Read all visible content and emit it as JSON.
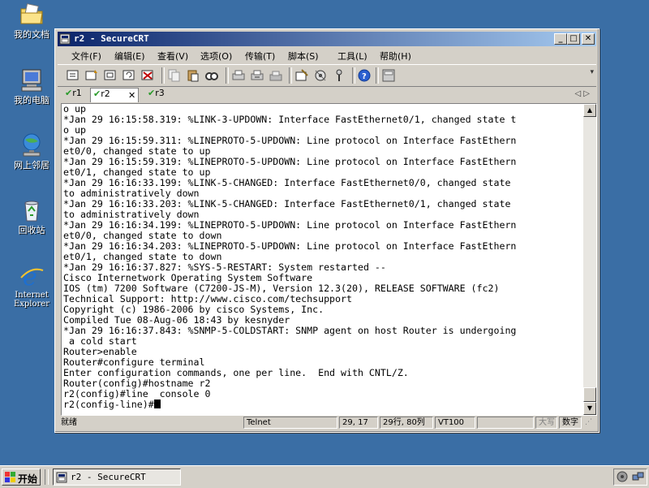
{
  "desktop": {
    "icons": [
      {
        "label": "我的文档",
        "icon": "folder-documents-icon"
      },
      {
        "label": "我的电脑",
        "icon": "computer-icon"
      },
      {
        "label": "网上邻居",
        "icon": "network-icon"
      },
      {
        "label": "回收站",
        "icon": "recycle-bin-icon"
      },
      {
        "label": "Internet Explorer",
        "icon": "ie-icon"
      }
    ]
  },
  "window": {
    "title": "r2 - SecureCRT",
    "controls": {
      "minimize": "_",
      "maximize": "□",
      "close": "✕"
    },
    "menu": [
      "文件(F)",
      "编辑(E)",
      "查看(V)",
      "选项(O)",
      "传输(T)",
      "脚本(S)",
      "工具(L)",
      "帮助(H)"
    ],
    "tabs": [
      {
        "label": "r1",
        "active": false
      },
      {
        "label": "r2",
        "active": true,
        "close": "✕"
      },
      {
        "label": "r3",
        "active": false
      }
    ],
    "tab_arrows": "◁ ▷",
    "terminal_lines": [
      "o up",
      "*Jan 29 16:15:58.319: %LINK-3-UPDOWN: Interface FastEthernet0/1, changed state t",
      "o up",
      "*Jan 29 16:15:59.311: %LINEPROTO-5-UPDOWN: Line protocol on Interface FastEthern",
      "et0/0, changed state to up",
      "*Jan 29 16:15:59.319: %LINEPROTO-5-UPDOWN: Line protocol on Interface FastEthern",
      "et0/1, changed state to up",
      "*Jan 29 16:16:33.199: %LINK-5-CHANGED: Interface FastEthernet0/0, changed state",
      "to administratively down",
      "*Jan 29 16:16:33.203: %LINK-5-CHANGED: Interface FastEthernet0/1, changed state",
      "to administratively down",
      "*Jan 29 16:16:34.199: %LINEPROTO-5-UPDOWN: Line protocol on Interface FastEthern",
      "et0/0, changed state to down",
      "*Jan 29 16:16:34.203: %LINEPROTO-5-UPDOWN: Line protocol on Interface FastEthern",
      "et0/1, changed state to down",
      "*Jan 29 16:16:37.827: %SYS-5-RESTART: System restarted --",
      "Cisco Internetwork Operating System Software",
      "IOS (tm) 7200 Software (C7200-JS-M), Version 12.3(20), RELEASE SOFTWARE (fc2)",
      "Technical Support: http://www.cisco.com/techsupport",
      "Copyright (c) 1986-2006 by cisco Systems, Inc.",
      "Compiled Tue 08-Aug-06 18:43 by kesnyder",
      "*Jan 29 16:16:37.843: %SNMP-5-COLDSTART: SNMP agent on host Router is undergoing",
      " a cold start",
      "Router>enable",
      "Router#configure terminal",
      "Enter configuration commands, one per line.  End with CNTL/Z.",
      "Router(config)#hostname r2",
      "r2(config)#line  console 0",
      "r2(config-line)#"
    ],
    "status": {
      "ready": "就绪",
      "protocol": "Telnet",
      "cursor_pos": "29, 17",
      "size": "29行, 80列",
      "emulation": "VT100",
      "caps": "大写",
      "num": "数字"
    }
  },
  "taskbar": {
    "start_label": "开始",
    "task_label": "r2 - SecureCRT"
  }
}
